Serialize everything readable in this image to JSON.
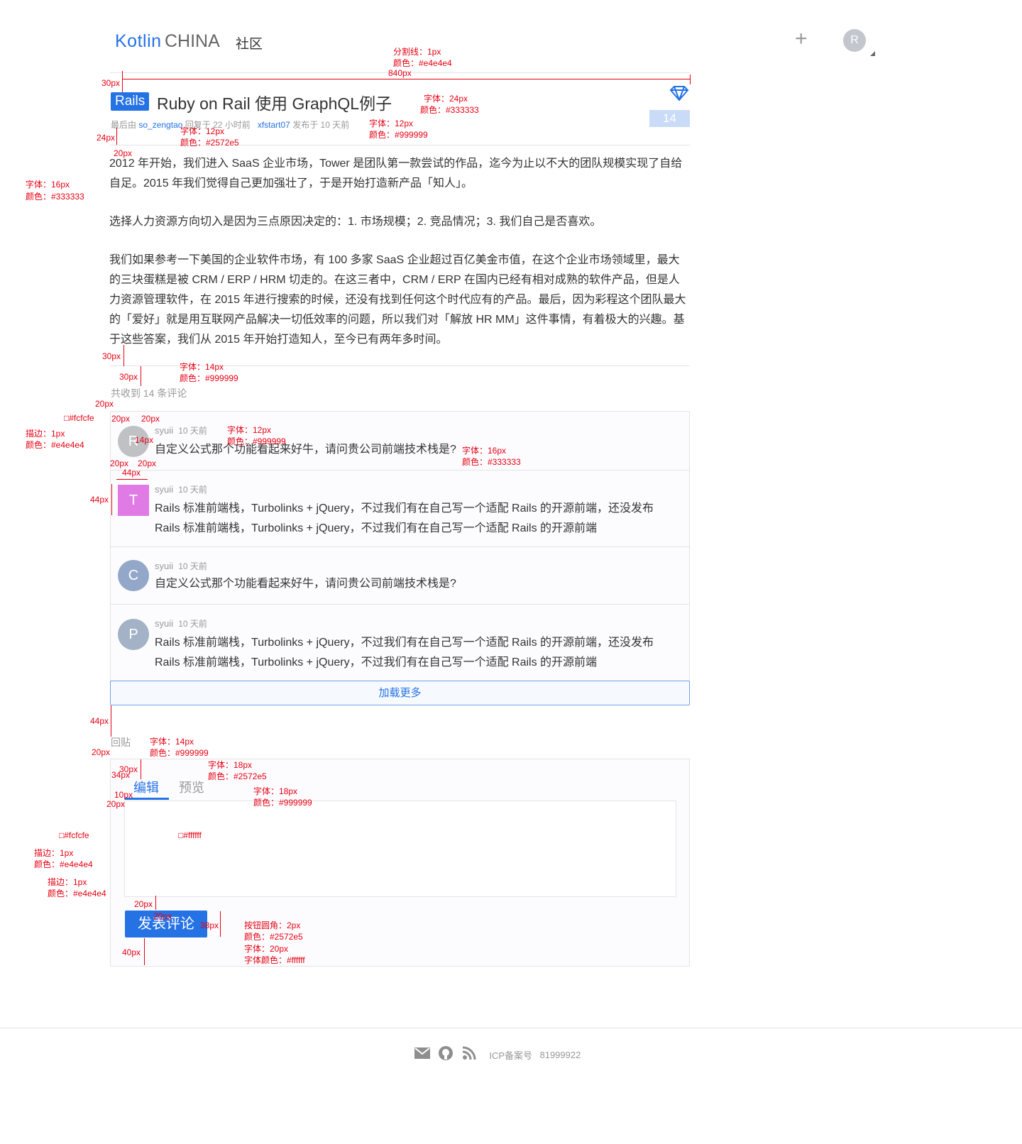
{
  "header": {
    "logo_kotlin": "Kotlin",
    "logo_china": "CHINA",
    "community": "社区",
    "plus": "+",
    "avatar": "R"
  },
  "topic": {
    "tag": "Rails",
    "title": "Ruby on Rail 使用 GraphQL例子",
    "reply_count": "14",
    "meta_prefix": "最后由",
    "meta_last_user": "so_zengtao",
    "meta_reply_time": "回复于 22 小时前",
    "meta_author": "xfstart07",
    "meta_publish_time": "发布于 10 天前",
    "body_p1": "2012 年开始，我们进入 SaaS 企业市场，Tower 是团队第一款尝试的作品，迄今为止以不大的团队规模实现了自给自足。2015 年我们觉得自己更加强壮了，于是开始打造新产品「知人」。",
    "body_p2": "选择人力资源方向切入是因为三点原因决定的：1. 市场规模；2. 竞品情况；3. 我们自己是否喜欢。",
    "body_p3": "我们如果参考一下美国的企业软件市场，有 100 多家 SaaS 企业超过百亿美金市值，在这个企业市场领域里，最大的三块蛋糕是被 CRM / ERP / HRM 切走的。在这三者中，CRM / ERP 在国内已经有相对成熟的软件产品，但是人力资源管理软件，在 2015 年进行搜索的时候，还没有找到任何这个时代应有的产品。最后，因为彩程这个团队最大的「爱好」就是用互联网产品解决一切低效率的问题，所以我们对「解放 HR MM」这件事情，有着极大的兴趣。基于这些答案，我们从 2015 年开始打造知人，至今已有两年多时间。"
  },
  "comments": {
    "count_text": "共收到 14 条评论",
    "items": [
      {
        "avatar": "R",
        "user": "syuii",
        "time": "10 天前",
        "text": "自定义公式那个功能看起来好牛，请问贵公司前端技术栈是?"
      },
      {
        "avatar": "T",
        "user": "syuii",
        "time": "10 天前",
        "text": "Rails 标准前端栈，Turbolinks + jQuery，不过我们有在自己写一个适配 Rails 的开源前端，还没发布Rails 标准前端栈，Turbolinks + jQuery，不过我们有在自己写一个适配 Rails 的开源前端"
      },
      {
        "avatar": "C",
        "user": "syuii",
        "time": "10 天前",
        "text": "自定义公式那个功能看起来好牛，请问贵公司前端技术栈是?"
      },
      {
        "avatar": "P",
        "user": "syuii",
        "time": "10 天前",
        "text": "Rails 标准前端栈，Turbolinks + jQuery，不过我们有在自己写一个适配 Rails 的开源前端，还没发布Rails 标准前端栈，Turbolinks + jQuery，不过我们有在自己写一个适配 Rails 的开源前端"
      }
    ],
    "load_more": "加载更多"
  },
  "reply": {
    "label": "回贴",
    "tab_edit": "编辑",
    "tab_preview": "预览",
    "submit": "发表评论"
  },
  "footer": {
    "icp_label": "ICP备案号",
    "icp_number": "81999922"
  },
  "annotations": {
    "divider_spec": "分割线：1px",
    "divider_color": "颜色：#e4e4e4",
    "w840": "840px",
    "title_font": "字体：24px",
    "title_color": "颜色：#333333",
    "meta_font_a": "字体：12px",
    "meta_color_a": "颜色：#2572e5",
    "meta_font_b": "字体：12px",
    "meta_color_b": "颜色：#999999",
    "body_font": "字体：16px",
    "body_color": "颜色：#333333",
    "count_font": "字体：14px",
    "count_color": "颜色：#999999",
    "bg_fcfcfe": "□#fcfcfe",
    "stroke": "描边：1px",
    "stroke_color": "颜色：#e4e4e4",
    "cm_meta_font": "字体：12px",
    "cm_meta_color": "颜色：#999999",
    "cm_text_font": "字体：16px",
    "cm_text_color": "颜色：#333333",
    "reply_font": "字体：14px",
    "reply_color": "颜色：#999999",
    "tab_a_font": "字体：18px",
    "tab_a_color": "颜色：#2572e5",
    "tab_b_font": "字体：18px",
    "tab_b_color": "颜色：#999999",
    "bg_ffffff": "□#ffffff",
    "bg_fcfcfe_2": "□#fcfcfe",
    "stroke_2": "描边：1px",
    "stroke_color_2": "颜色：#e4e4e4",
    "stroke_3": "描边：1px",
    "stroke_color_3": "颜色：#e4e4e4",
    "btn_radius": "按钮圆角：2px",
    "btn_color": "颜色：#2572e5",
    "btn_font": "字体：20px",
    "btn_font_color": "字体颜色：#ffffff",
    "d30a": "30px",
    "d24": "24px",
    "d20a": "20px",
    "d30b": "30px",
    "d30c": "30px",
    "d20b": "20px",
    "d20c": "20px",
    "d20d": "20px",
    "d14": "14px",
    "d20e": "20px",
    "d20f": "20px",
    "d44a": "44px",
    "d44b": "44px",
    "d44c": "44px",
    "d20g": "20px",
    "d30d": "30px",
    "d34": "34px",
    "d10": "10px",
    "d20h": "20px",
    "d20i": "20px",
    "d20j": "20px",
    "d38": "38px",
    "d40": "40px"
  },
  "colors": {
    "accent": "#2572e5",
    "text": "#333333",
    "muted": "#999999",
    "border": "#e4e4e4",
    "panel_bg": "#fcfcfe",
    "annotation": "#e60012"
  }
}
